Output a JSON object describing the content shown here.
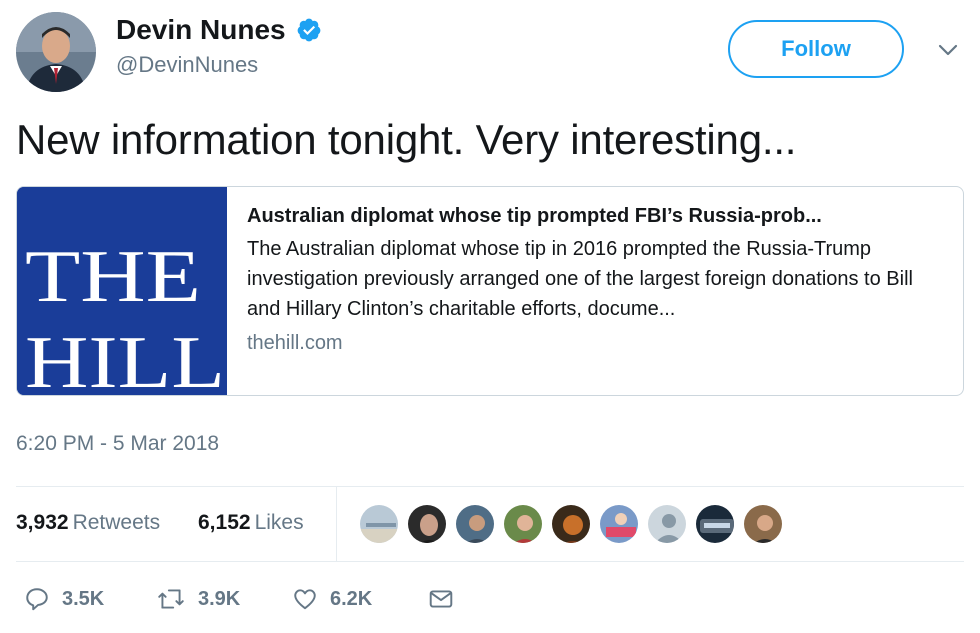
{
  "author": {
    "display_name": "Devin Nunes",
    "handle": "@DevinNunes",
    "verified": true,
    "verified_icon": "verified-badge-icon"
  },
  "follow_label": "Follow",
  "tweet": {
    "text": "New information tonight. Very interesting..."
  },
  "card": {
    "logo_lines": [
      "THE",
      "HILL"
    ],
    "title": "Australian diplomat whose tip prompted FBI’s Russia-prob...",
    "description": "The Australian diplomat whose tip in 2016 prompted the Russia-Trump investigation previously arranged one of the largest foreign donations to Bill and Hillary Clinton’s charitable efforts, docume...",
    "domain": "thehill.com"
  },
  "timestamp": "6:20 PM - 5 Mar 2018",
  "stats": {
    "retweets_count": "3,932",
    "retweets_label": "Retweets",
    "likes_count": "6,152",
    "likes_label": "Likes"
  },
  "actions": {
    "reply_count": "3.5K",
    "retweet_count": "3.9K",
    "like_count": "6.2K"
  },
  "colors": {
    "accent": "#1da1f2",
    "muted": "#657786",
    "hill_blue": "#1a3d99"
  }
}
